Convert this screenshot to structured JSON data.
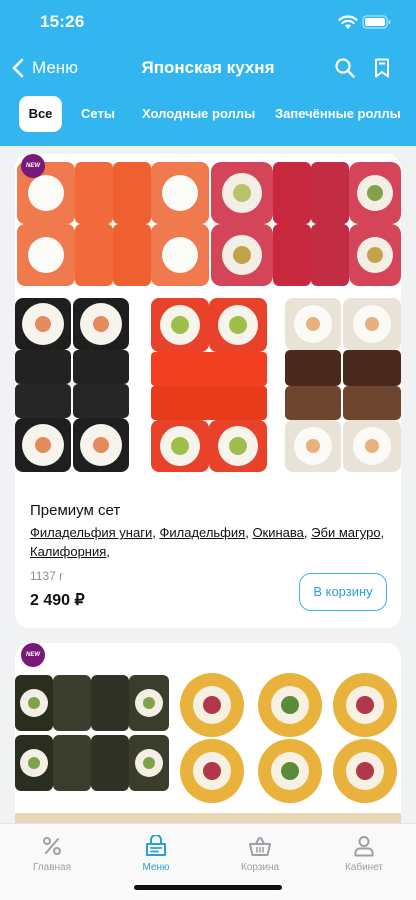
{
  "status_bar": {
    "time": "15:26"
  },
  "nav": {
    "back_label": "Меню",
    "title": "Японская кухня"
  },
  "tabs": [
    {
      "label": "Все",
      "active": true
    },
    {
      "label": "Сеты",
      "active": false
    },
    {
      "label": "Холодные роллы",
      "active": false
    },
    {
      "label": "Запечённые роллы",
      "active": false
    }
  ],
  "products": [
    {
      "badge": "NEW",
      "title": "Премиум сет",
      "ingredients": [
        "Филадельфия унаги",
        "Филадельфия",
        "Окинава",
        "Эби магуро",
        "Калифорния"
      ],
      "ingredient_separator": ", ",
      "weight": "1137 г",
      "price": "2 490 ₽",
      "cart_label": "В корзину"
    },
    {
      "badge": "NEW"
    }
  ],
  "tabbar": {
    "items": [
      {
        "label": "Главная",
        "icon": "percent-icon",
        "active": false
      },
      {
        "label": "Меню",
        "icon": "menu-bag-icon",
        "active": true
      },
      {
        "label": "Корзина",
        "icon": "basket-icon",
        "active": false
      },
      {
        "label": "Кабинет",
        "icon": "user-icon",
        "active": false
      }
    ]
  },
  "colors": {
    "accent": "#33b6f0",
    "badge": "#7a1a78"
  }
}
